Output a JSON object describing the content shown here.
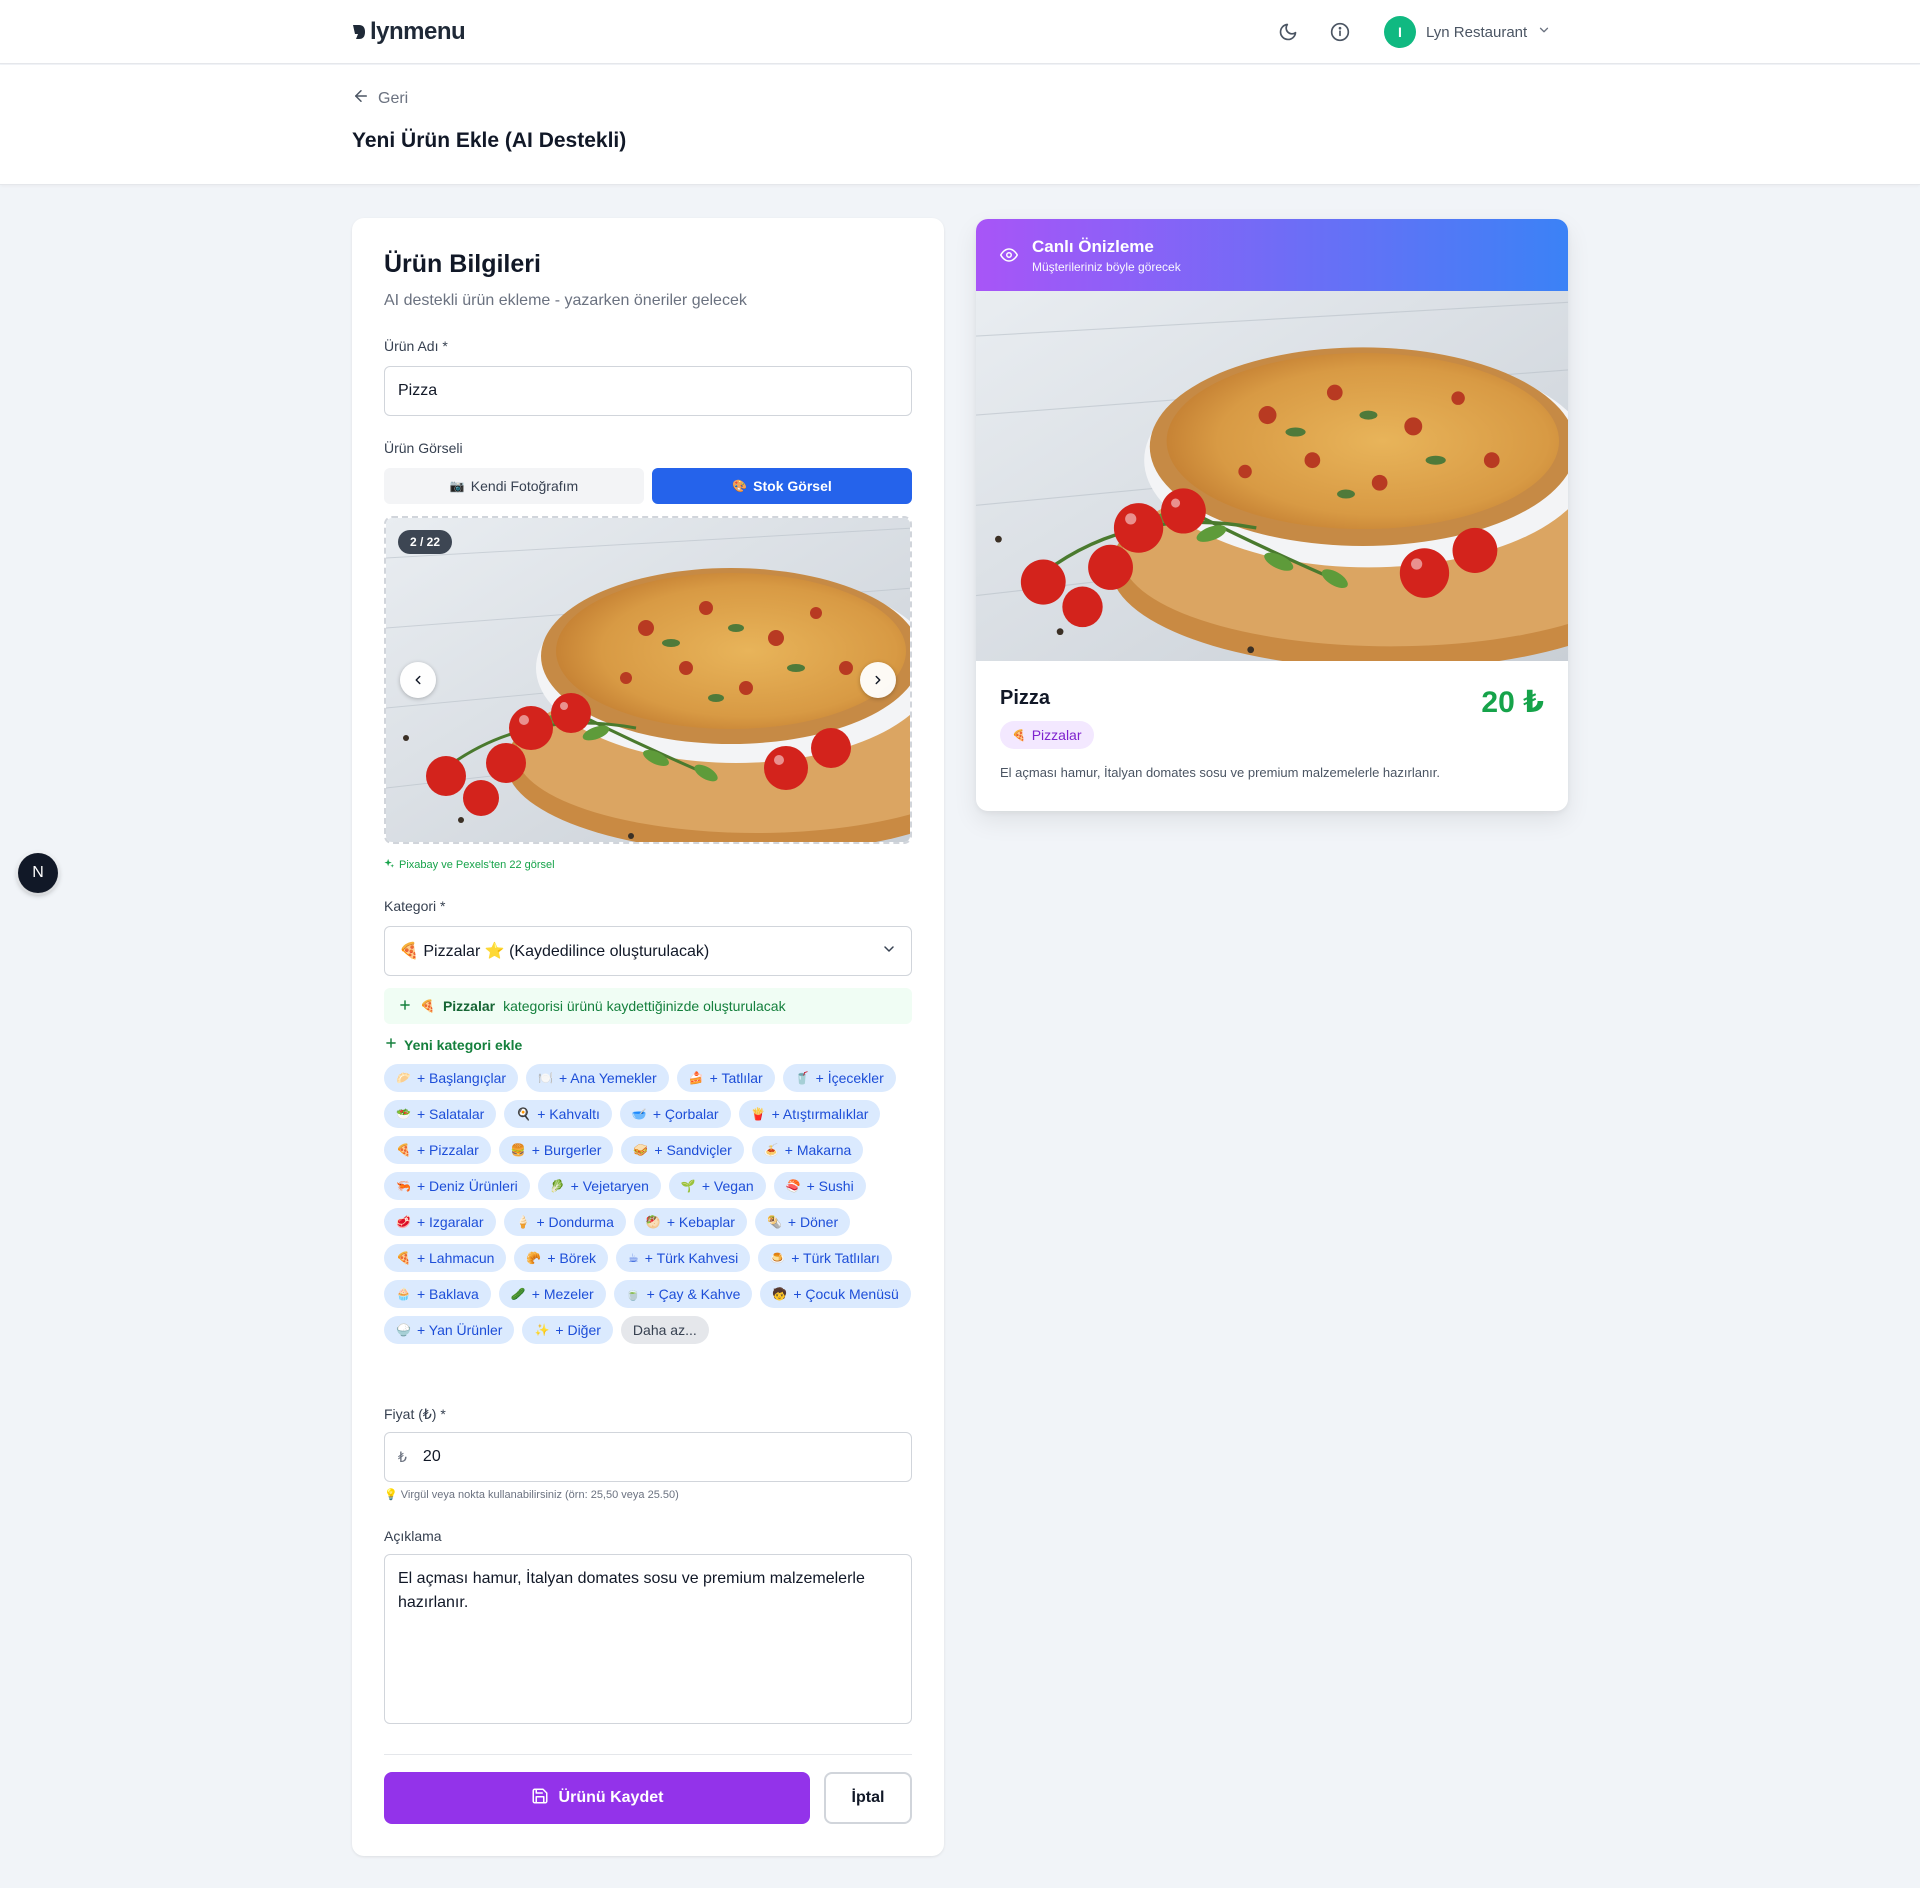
{
  "nav": {
    "logo_text": "lynmenu",
    "user_initial": "I",
    "user_name": "Lyn Restaurant"
  },
  "header": {
    "back_label": "Geri",
    "title": "Yeni Ürün Ekle (AI Destekli)"
  },
  "form": {
    "title": "Ürün Bilgileri",
    "subtitle": "AI destekli ürün ekleme - yazarken öneriler gelecek",
    "name_label": "Ürün Adı *",
    "name_value": "Pizza",
    "image_label": "Ürün Görseli",
    "tab_own": "Kendi Fotoğrafım",
    "tab_own_icon": "📷",
    "tab_stock": "Stok Görsel",
    "tab_stock_icon": "🎨",
    "image_counter": "2 / 22",
    "source_note": "Pixabay ve Pexels'ten 22 görsel",
    "category_label": "Kategori *",
    "category_value": "🍕 Pizzalar ⭐ (Kaydedilince oluşturulacak)",
    "notice_icon": "🍕",
    "notice_bold": "Pizzalar",
    "notice_rest": "kategorisi ürünü kaydettiğinizde oluşturulacak",
    "new_category": "Yeni kategori ekle",
    "chips": [
      {
        "emoji": "🥟",
        "label": "+ Başlangıçlar"
      },
      {
        "emoji": "🍽️",
        "label": "+ Ana Yemekler"
      },
      {
        "emoji": "🍰",
        "label": "+ Tatlılar"
      },
      {
        "emoji": "🥤",
        "label": "+ İçecekler"
      },
      {
        "emoji": "🥗",
        "label": "+ Salatalar"
      },
      {
        "emoji": "🍳",
        "label": "+ Kahvaltı"
      },
      {
        "emoji": "🥣",
        "label": "+ Çorbalar"
      },
      {
        "emoji": "🍟",
        "label": "+ Atıştırmalıklar"
      },
      {
        "emoji": "🍕",
        "label": "+ Pizzalar"
      },
      {
        "emoji": "🍔",
        "label": "+ Burgerler"
      },
      {
        "emoji": "🥪",
        "label": "+ Sandviçler"
      },
      {
        "emoji": "🍝",
        "label": "+ Makarna"
      },
      {
        "emoji": "🦐",
        "label": "+ Deniz Ürünleri"
      },
      {
        "emoji": "🥬",
        "label": "+ Vejetaryen"
      },
      {
        "emoji": "🌱",
        "label": "+ Vegan"
      },
      {
        "emoji": "🍣",
        "label": "+ Sushi"
      },
      {
        "emoji": "🥩",
        "label": "+ Izgaralar"
      },
      {
        "emoji": "🍦",
        "label": "+ Dondurma"
      },
      {
        "emoji": "🥙",
        "label": "+ Kebaplar"
      },
      {
        "emoji": "🌯",
        "label": "+ Döner"
      },
      {
        "emoji": "🍕",
        "label": "+ Lahmacun"
      },
      {
        "emoji": "🥐",
        "label": "+ Börek"
      },
      {
        "emoji": "☕",
        "label": "+ Türk Kahvesi"
      },
      {
        "emoji": "🍮",
        "label": "+ Türk Tatlıları"
      },
      {
        "emoji": "🧁",
        "label": "+ Baklava"
      },
      {
        "emoji": "🥒",
        "label": "+ Mezeler"
      },
      {
        "emoji": "🍵",
        "label": "+ Çay & Kahve"
      },
      {
        "emoji": "🧒",
        "label": "+ Çocuk Menüsü"
      },
      {
        "emoji": "🍚",
        "label": "+ Yan Ürünler"
      },
      {
        "emoji": "✨",
        "label": "+ Diğer"
      }
    ],
    "less_label": "Daha az...",
    "price_label": "Fiyat (₺) *",
    "currency_symbol": "₺",
    "price_value": "20",
    "price_hint": "💡 Virgül veya nokta kullanabilirsiniz (örn: 25,50 veya 25.50)",
    "desc_label": "Açıklama",
    "desc_value": "El açması hamur, İtalyan domates sosu ve premium malzemelerle hazırlanır.",
    "save_label": "Ürünü Kaydet",
    "cancel_label": "İptal"
  },
  "preview": {
    "title": "Canlı Önizleme",
    "subtitle": "Müşterileriniz böyle görecek",
    "product_name": "Pizza",
    "price": "20 ₺",
    "badge_icon": "🍕",
    "badge_label": "Pizzalar",
    "description": "El açması hamur, İtalyan domates sosu ve premium malzemelerle hazırlanır."
  },
  "dev_badge": "N",
  "colors": {
    "primary_blue": "#2563eb",
    "save_purple": "#9333ea",
    "price_green": "#16a34a",
    "chip_bg": "#dbeafe",
    "chip_text": "#1d4ed8"
  }
}
